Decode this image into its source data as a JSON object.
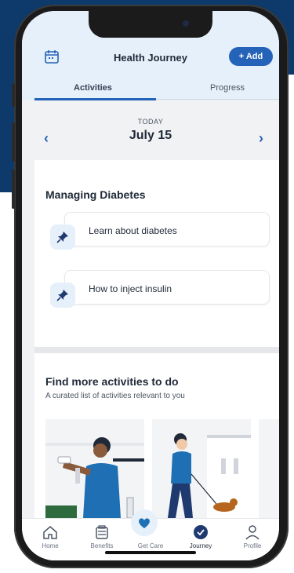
{
  "header": {
    "title": "Health Journey",
    "add_label": "+ Add",
    "calendar_icon": "calendar-icon"
  },
  "tabs": [
    {
      "label": "Activities",
      "active": true
    },
    {
      "label": "Progress",
      "active": false
    }
  ],
  "date_nav": {
    "caption": "TODAY",
    "date": "July 15",
    "prev_icon": "chevron-left-icon",
    "next_icon": "chevron-right-icon"
  },
  "managing": {
    "title": "Managing Diabetes",
    "items": [
      {
        "label": "Learn about diabetes",
        "icon": "pin-icon"
      },
      {
        "label": "How to inject insulin",
        "icon": "pin-icon"
      }
    ]
  },
  "more": {
    "title": "Find more activities to do",
    "subtitle": "A curated list of activities relevant to you"
  },
  "nav": [
    {
      "label": "Home",
      "icon": "home-icon"
    },
    {
      "label": "Benefits",
      "icon": "benefits-icon"
    },
    {
      "label": "Get Care",
      "icon": "heart-icon"
    },
    {
      "label": "Journey",
      "icon": "journey-icon",
      "active": true
    },
    {
      "label": "Profile",
      "icon": "profile-icon"
    }
  ],
  "colors": {
    "accent": "#2563b8",
    "app_bar": "#e6f0fb",
    "navy_bg": "#0e3a6b"
  }
}
